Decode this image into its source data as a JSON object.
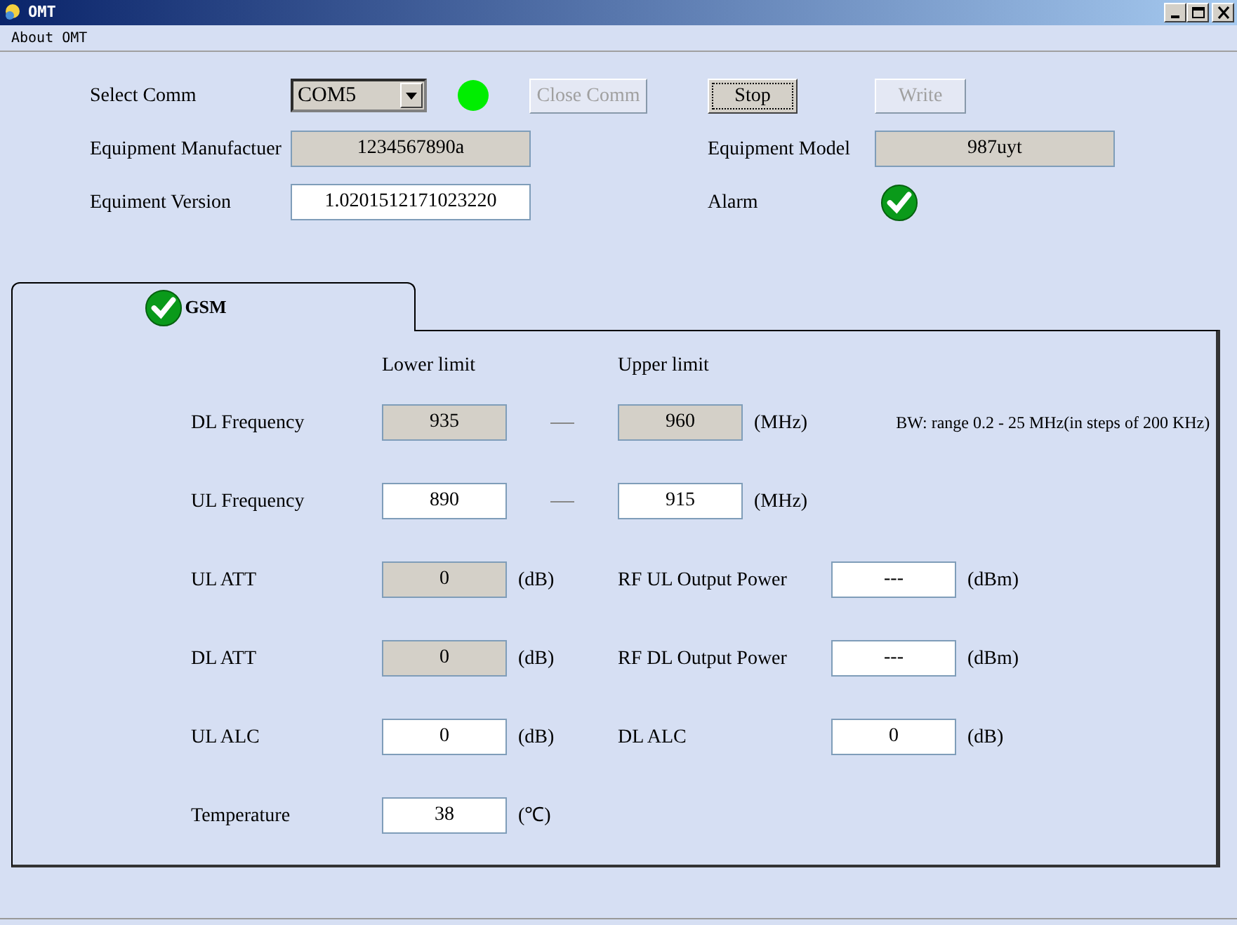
{
  "window": {
    "title": "OMT"
  },
  "menu": [
    "About OMT"
  ],
  "comm": {
    "label": "Select Comm",
    "port": "COM5",
    "connected": true
  },
  "buttons": [
    {
      "label": "Close Comm",
      "disabled": true,
      "focused": false
    },
    {
      "label": "Stop",
      "disabled": false,
      "focused": true
    },
    {
      "label": "Write",
      "disabled": true,
      "focused": false
    }
  ],
  "info": [
    {
      "label": "Equipment Manufactuer",
      "value": "1234567890a",
      "readonly": true
    },
    {
      "label": "Equipment Model",
      "value": "987uyt",
      "readonly": true
    },
    {
      "label": "Equiment Version",
      "value": "1.0201512171023220",
      "readonly": false
    }
  ],
  "alarm": {
    "label": "Alarm",
    "ok": true
  },
  "tabs": [
    {
      "label": "GSM",
      "selected": true,
      "ok": true
    }
  ],
  "columns": [
    "Lower limit",
    "Upper limit"
  ],
  "rows": [
    {
      "kind": "range",
      "label": "DL Frequency",
      "lower": {
        "value": "935",
        "readonly": true
      },
      "upper": {
        "value": "960",
        "readonly": true
      },
      "unit": "(MHz)",
      "note": "BW: range 0.2 - 25 MHz(in steps of 200 KHz)"
    },
    {
      "kind": "range",
      "label": "UL Frequency",
      "lower": {
        "value": "890",
        "readonly": false
      },
      "upper": {
        "value": "915",
        "readonly": false
      },
      "unit": "(MHz)"
    },
    {
      "kind": "pair",
      "label": "UL ATT",
      "value": "0",
      "readonly": true,
      "unit": "(dB)",
      "label2": "RF UL Output Power",
      "value2": "---",
      "readonly2": false,
      "unit2": "(dBm)"
    },
    {
      "kind": "pair",
      "label": "DL ATT",
      "value": "0",
      "readonly": true,
      "unit": "(dB)",
      "label2": "RF DL Output Power",
      "value2": "---",
      "readonly2": false,
      "unit2": "(dBm)"
    },
    {
      "kind": "pair",
      "label": "UL ALC",
      "value": "0",
      "readonly": false,
      "unit": "(dB)",
      "label2": "DL ALC",
      "value2": "0",
      "readonly2": false,
      "unit2": "(dB)"
    },
    {
      "kind": "single",
      "label": "Temperature",
      "value": "38",
      "readonly": false,
      "unit": "(℃)"
    }
  ]
}
